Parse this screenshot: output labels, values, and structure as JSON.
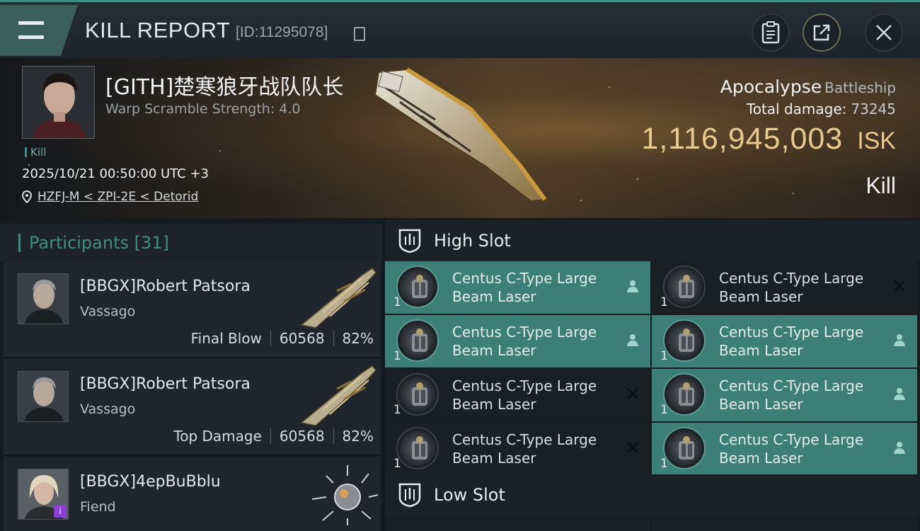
{
  "header": {
    "title": "KILL REPORT",
    "report_id": "[ID:11295078]"
  },
  "victim": {
    "name": "[GITH]楚寒狼牙战队队长",
    "warp_scramble": "Warp Scramble Strength: 4.0",
    "tag": "Kill",
    "datetime": "2025/10/21 00:50:00 UTC +3",
    "location": "HZFJ-M < ZPI-2E < Detorid",
    "ship": "Apocalypse",
    "ship_class": "Battleship",
    "total_damage_label": "Total damage:",
    "total_damage": "73245",
    "isk_value": "1,116,945,003",
    "isk_unit": "ISK",
    "result": "Kill"
  },
  "participants": {
    "label": "Participants",
    "count": "[31]",
    "items": [
      {
        "name": "[BBGX]Robert Patsora",
        "ship": "Vassago",
        "role": "Final Blow",
        "damage": "60568",
        "percent": "82%"
      },
      {
        "name": "[BBGX]Robert Patsora",
        "ship": "Vassago",
        "role": "Top Damage",
        "damage": "60568",
        "percent": "82%"
      },
      {
        "name": "[BBGX]4epBuBblu",
        "ship": "Fiend"
      }
    ]
  },
  "slots": {
    "high_label": "High Slot",
    "low_label": "Low Slot",
    "high": [
      {
        "line1": "Centus C-Type Large",
        "line2": "Beam Laser",
        "qty": "1",
        "status": "dropped"
      },
      {
        "line1": "Centus C-Type Large",
        "line2": "Beam Laser",
        "qty": "1",
        "status": "destroyed"
      },
      {
        "line1": "Centus C-Type Large",
        "line2": "Beam Laser",
        "qty": "1",
        "status": "dropped"
      },
      {
        "line1": "Centus C-Type Large",
        "line2": "Beam Laser",
        "qty": "1",
        "status": "dropped"
      },
      {
        "line1": "Centus C-Type Large",
        "line2": "Beam Laser",
        "qty": "1",
        "status": "destroyed"
      },
      {
        "line1": "Centus C-Type Large",
        "line2": "Beam Laser",
        "qty": "1",
        "status": "dropped"
      },
      {
        "line1": "Centus C-Type Large",
        "line2": "Beam Laser",
        "qty": "1",
        "status": "destroyed"
      },
      {
        "line1": "Centus C-Type Large",
        "line2": "Beam Laser",
        "qty": "1",
        "status": "dropped"
      }
    ]
  },
  "colors": {
    "accent": "#3b7f78",
    "isk": "#e9c98f",
    "background": "#161b20"
  }
}
